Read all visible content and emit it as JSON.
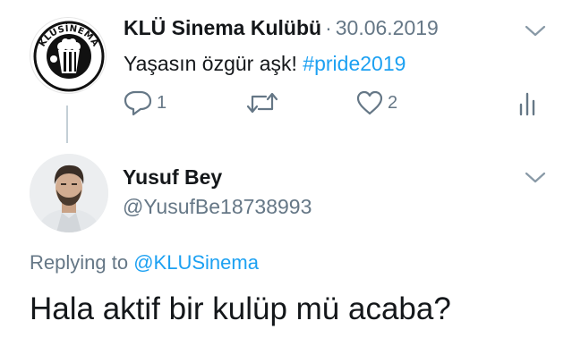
{
  "tweet1": {
    "avatar_logo_text": "KLÜSİNEMA",
    "display_name": "KLÜ Sinema Kulübü",
    "separator": "·",
    "date": "30.06.2019",
    "text": "Yaşasın özgür aşk!",
    "hashtag": "#pride2019",
    "reply_count": "1",
    "like_count": "2"
  },
  "tweet2": {
    "display_name": "Yusuf Bey",
    "handle": "@YusufBe18738993",
    "replying_label": "Replying to",
    "replying_to": "@KLUSinema",
    "text": "Hala aktif bir kulüp mü acaba?"
  },
  "icons": {
    "reply": "reply-icon",
    "retweet": "retweet-icon",
    "like": "heart-icon",
    "analytics": "analytics-icon",
    "more": "chevron-down-icon"
  },
  "colors": {
    "link": "#1da1f2",
    "secondary_text": "#657786",
    "primary_text": "#14171a",
    "thread_line": "#c4cfd6"
  }
}
